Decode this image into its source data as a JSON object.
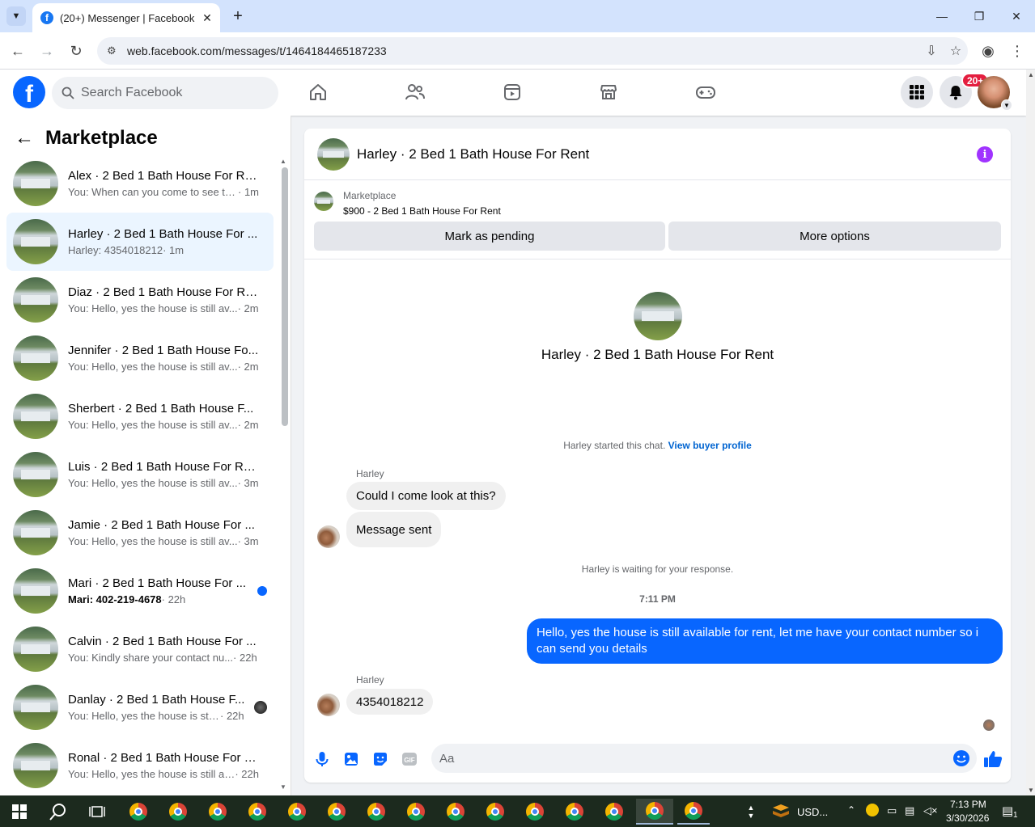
{
  "browser": {
    "tab_title": "(20+) Messenger | Facebook",
    "url": "web.facebook.com/messages/t/1464184465187233"
  },
  "header": {
    "search_placeholder": "Search Facebook",
    "notif_badge": "20+"
  },
  "left": {
    "title": "Marketplace",
    "conversations": [
      {
        "name": "Alex · 2 Bed 1 Bath House For Re...",
        "snippet": "You: When can you come to see th...",
        "time": " · 1m"
      },
      {
        "name": "Harley · 2 Bed 1 Bath House For ...",
        "snippet": "Harley: 4354018212",
        "time": " · 1m"
      },
      {
        "name": "Diaz · 2 Bed 1 Bath House For Re...",
        "snippet": "You: Hello, yes the house is still av...",
        "time": " · 2m"
      },
      {
        "name": "Jennifer · 2 Bed 1 Bath House Fo...",
        "snippet": "You: Hello, yes the house is still av...",
        "time": " · 2m"
      },
      {
        "name": "Sherbert · 2 Bed 1 Bath House F...",
        "snippet": "You: Hello, yes the house is still av...",
        "time": " · 2m"
      },
      {
        "name": "Luis · 2 Bed 1 Bath House For Rent",
        "snippet": "You: Hello, yes the house is still av...",
        "time": " · 3m"
      },
      {
        "name": "Jamie · 2 Bed 1 Bath House For ...",
        "snippet": "You: Hello, yes the house is still av...",
        "time": " · 3m"
      },
      {
        "name": "Mari · 2 Bed 1 Bath House For ...",
        "snippet": "Mari: 402-219-4678",
        "time": " · 22h"
      },
      {
        "name": "Calvin · 2 Bed 1 Bath House For ...",
        "snippet": "You: Kindly share your contact nu...",
        "time": " · 22h"
      },
      {
        "name": "Danlay · 2 Bed 1 Bath House F...",
        "snippet": "You: Hello, yes the house is still...",
        "time": " · 22h"
      },
      {
        "name": "Ronal · 2 Bed 1 Bath House For R...",
        "snippet": "You: Hello, yes the house is still av...",
        "time": " · 22h"
      }
    ]
  },
  "chat": {
    "title": "Harley · 2 Bed 1 Bath House For Rent",
    "marketplace_label": "Marketplace",
    "listing": "$900 - 2 Bed 1 Bath House For Rent",
    "btn_pending": "Mark as pending",
    "btn_more": "More options",
    "center_title": "Harley · 2 Bed 1 Bath House For Rent",
    "started_text": "Harley started this chat.",
    "view_profile": "View buyer profile",
    "sender_name": "Harley",
    "msg1": "Could I come look at this?",
    "msg2": "Message sent",
    "waiting": "Harley is waiting for your response.",
    "timestamp": "7:11 PM",
    "my_msg": "Hello, yes the house is still available for rent, let me have your contact number so i can send you  details",
    "sender_name2": "Harley",
    "msg3": "4354018212",
    "composer_placeholder": "Aa"
  },
  "taskbar": {
    "weather": "USD...",
    "time": "7:13 PM",
    "date": "3/30/2026",
    "notif_count": "1"
  },
  "colors": {
    "accent": "#0866ff",
    "info": "#a033ff",
    "badge": "#e41e3f"
  }
}
